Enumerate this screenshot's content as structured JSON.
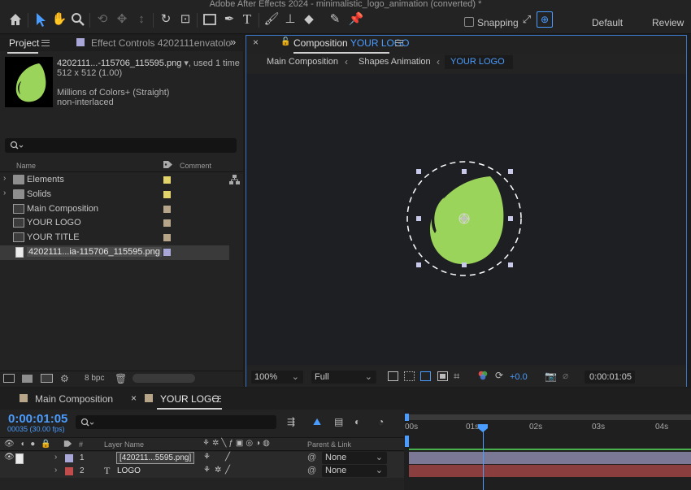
{
  "app": {
    "window_title": "Adobe After Effects 2024 - minimalistic_logo_animation (converted) *"
  },
  "toolbar": {
    "tools": [
      "home-icon",
      "selection-icon",
      "hand-icon",
      "zoom-icon",
      "orbit-icon",
      "pan-icon",
      "dolly-icon",
      "rotate-icon",
      "anchor-icon",
      "rectangle-icon",
      "pen-icon",
      "text-icon",
      "brush-icon",
      "clone-stamp-icon",
      "eraser-icon",
      "roto-brush-icon",
      "puppet-pin-icon"
    ],
    "active_tool": "selection-icon",
    "snapping_label": "Snapping",
    "workspace_default": "Default",
    "workspace_review": "Review",
    "accent": "#4a9cff"
  },
  "project": {
    "tab_label": "Project",
    "effect_controls_label": "Effect Controls 4202111envatolo",
    "item_name": "4202111...-115706_115595.png",
    "used": ", used 1 time",
    "dims": "512 x 512 (1.00)",
    "colors": "Millions of Colors+ (Straight)",
    "interlace": "non-interlaced",
    "col_name": "Name",
    "col_comment": "Comment",
    "bpc": "8 bpc",
    "items": [
      {
        "name": "Elements",
        "type": "folder",
        "color": "#e3d36b"
      },
      {
        "name": "Solids",
        "type": "folder",
        "color": "#e3d36b"
      },
      {
        "name": "Main Composition",
        "type": "comp",
        "color": "#b7a58a"
      },
      {
        "name": "YOUR LOGO",
        "type": "comp",
        "color": "#b7a58a"
      },
      {
        "name": "YOUR TITLE",
        "type": "comp",
        "color": "#b7a58a"
      },
      {
        "name": "4202111...ia-115706_115595.png",
        "type": "png",
        "color": "#a9a6d8"
      }
    ]
  },
  "composition": {
    "tab_prefix": "Composition",
    "tab_name": "YOUR LOGO",
    "breadcrumbs": [
      "Main Composition",
      "Shapes Animation",
      "YOUR LOGO"
    ],
    "zoom": "100%",
    "resolution": "Full",
    "exposure": "+0.0",
    "timecode": "0:00:01:05",
    "logo_color": "#9bd45a"
  },
  "timeline": {
    "tabs": [
      "Main Composition",
      "YOUR LOGO"
    ],
    "timecode": "0:00:01:05",
    "frames": "00035 (30.00 fps)",
    "col_layer_name": "Layer Name",
    "col_parent": "Parent & Link",
    "ruler": [
      "00s",
      "01s",
      "02s",
      "03s",
      "04s"
    ],
    "layers": [
      {
        "num": "1",
        "name": "[420211...5595.png]",
        "parent": "None",
        "color": "#a9a6d8"
      },
      {
        "num": "2",
        "name": "LOGO",
        "parent": "None",
        "color": "#c24b4b"
      }
    ]
  }
}
